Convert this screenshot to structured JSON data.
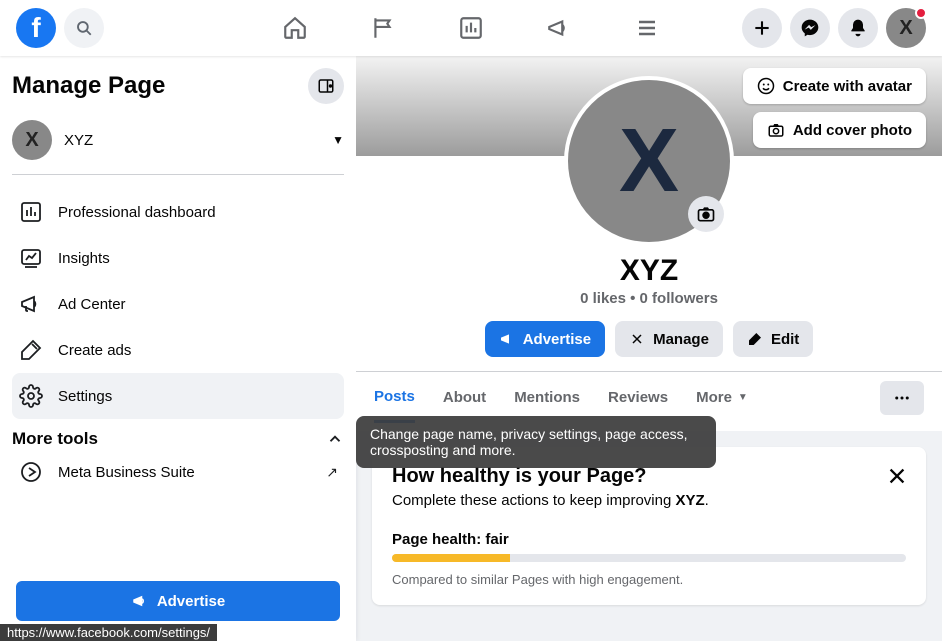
{
  "topbar": {
    "avatar_letter": "X"
  },
  "sidebar": {
    "title": "Manage Page",
    "page_label": "XYZ",
    "items": [
      {
        "label": "Professional dashboard"
      },
      {
        "label": "Insights"
      },
      {
        "label": "Ad Center"
      },
      {
        "label": "Create ads"
      },
      {
        "label": "Settings"
      }
    ],
    "more_tools_label": "More tools",
    "meta_suite_label": "Meta Business Suite",
    "advertise_label": "Advertise"
  },
  "tooltip": {
    "text": "Change page name, privacy settings, page access, crossposting and more."
  },
  "cover": {
    "avatar_btn_label": "Create with avatar",
    "photo_btn_label": "Add cover photo"
  },
  "profile": {
    "avatar_letter": "X",
    "name": "XYZ",
    "stats": "0 likes • 0 followers",
    "advertise_label": "Advertise",
    "manage_label": "Manage",
    "edit_label": "Edit"
  },
  "tabs": {
    "posts": "Posts",
    "about": "About",
    "mentions": "Mentions",
    "reviews": "Reviews",
    "more": "More"
  },
  "health_card": {
    "title": "How healthy is your Page?",
    "subtitle_prefix": "Complete these actions to keep improving ",
    "subtitle_bold": "XYZ",
    "subtitle_suffix": ".",
    "health_label": "Page health: fair",
    "fill_percent": 23,
    "compare": "Compared to similar Pages with high engagement."
  },
  "status_url": "https://www.facebook.com/settings/"
}
